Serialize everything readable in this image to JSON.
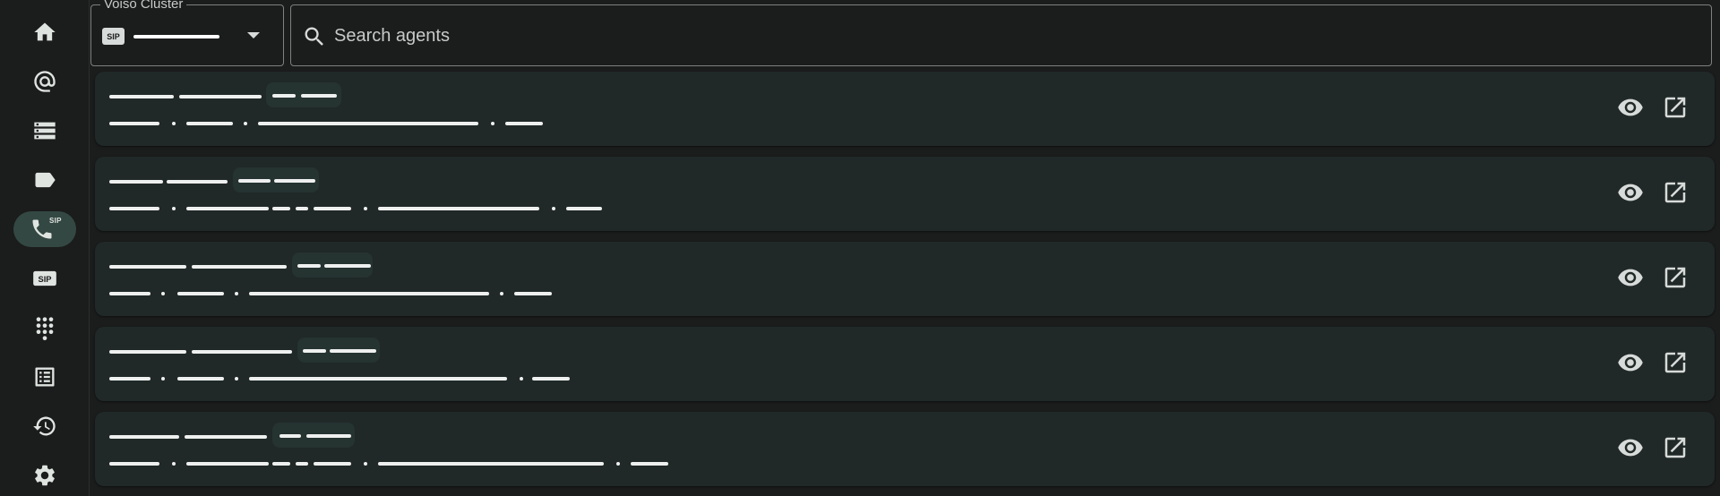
{
  "sidebar": {
    "items": [
      {
        "name": "home",
        "icon": "home-icon"
      },
      {
        "name": "mentions",
        "icon": "at-icon"
      },
      {
        "name": "servers",
        "icon": "storage-icon"
      },
      {
        "name": "labels",
        "icon": "label-icon"
      },
      {
        "name": "sip-calls",
        "icon": "sip-phone-icon",
        "badge": "SIP",
        "active": true
      },
      {
        "name": "sip",
        "icon": "sip-icon",
        "badge": "SIP"
      },
      {
        "name": "dialpad",
        "icon": "dialpad-icon"
      },
      {
        "name": "list",
        "icon": "list-icon"
      },
      {
        "name": "history",
        "icon": "history-icon"
      },
      {
        "name": "settings",
        "icon": "gear-icon"
      }
    ]
  },
  "cluster": {
    "label": "Voiso Cluster",
    "badge": "SIP"
  },
  "search": {
    "placeholder": "Search agents"
  },
  "agents": [
    {
      "actions": [
        "view-icon",
        "open-external-icon"
      ]
    },
    {
      "actions": [
        "view-icon",
        "open-external-icon"
      ]
    },
    {
      "actions": [
        "view-icon",
        "open-external-icon"
      ]
    },
    {
      "actions": [
        "view-icon",
        "open-external-icon"
      ]
    },
    {
      "actions": [
        "view-icon",
        "open-external-icon"
      ]
    }
  ],
  "colors": {
    "background": "#1b1c1c",
    "card": "#202928",
    "chip": "#253331",
    "active_nav": "#344843",
    "text": "#e4e6e4"
  }
}
